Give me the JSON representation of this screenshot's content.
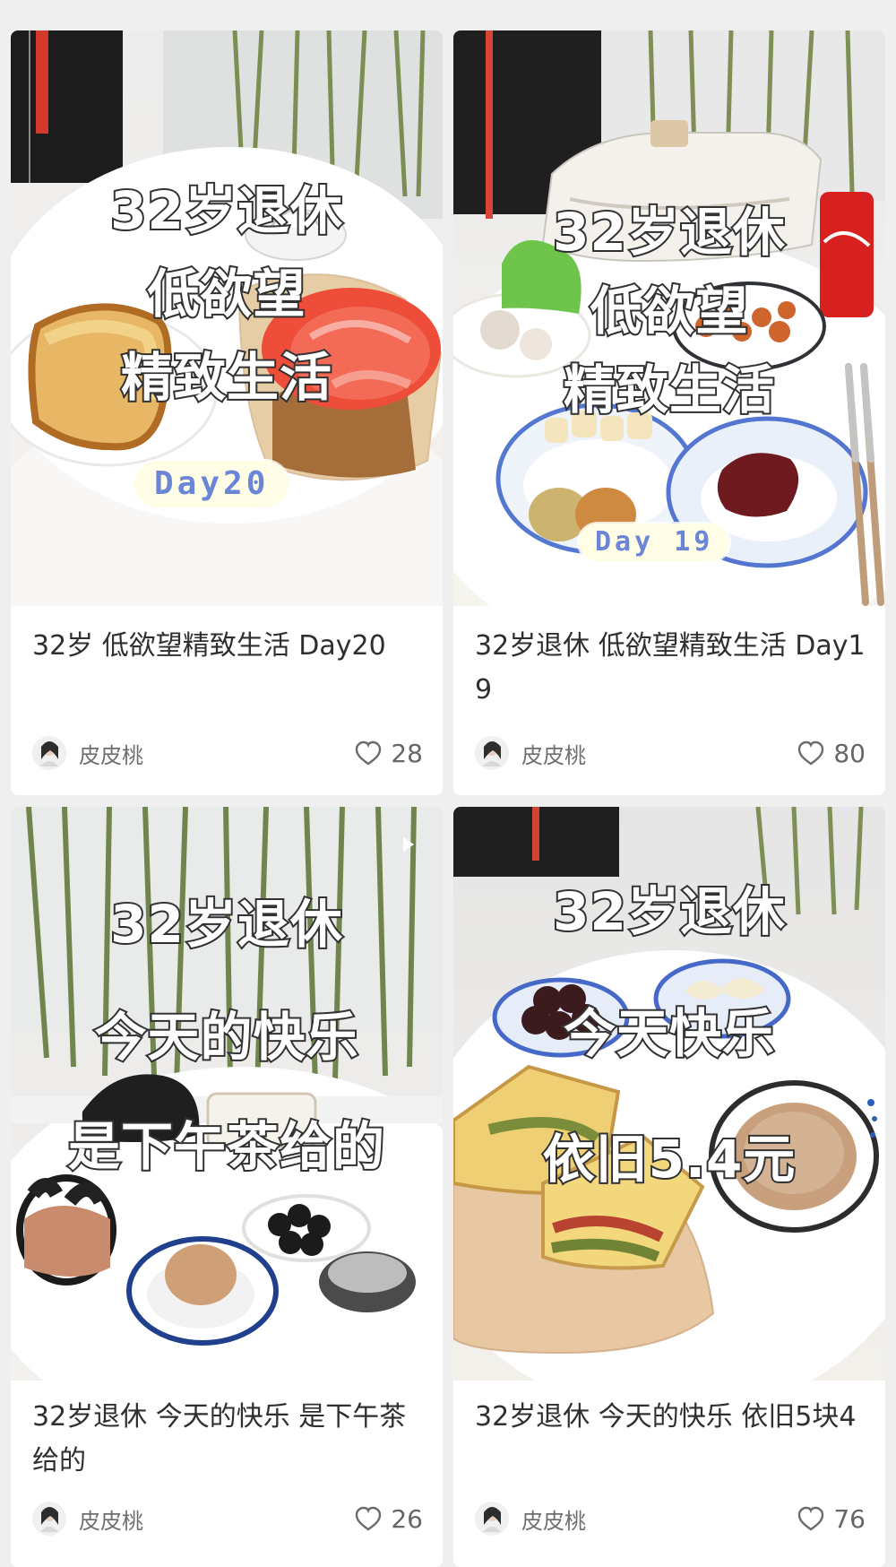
{
  "feed": {
    "cards": [
      {
        "image_text": [
          "32岁退休",
          "低欲望",
          "精致生活"
        ],
        "chip": "Day20",
        "title": "32岁 低欲望精致生活 Day20",
        "author": "皮皮桃",
        "likes": "28"
      },
      {
        "image_text": [
          "32岁退休",
          "低欲望",
          "精致生活"
        ],
        "chip": "Day 19",
        "title": "32岁退休 低欲望精致生活 Day19",
        "author": "皮皮桃",
        "likes": "80"
      },
      {
        "image_text": [
          "32岁退休",
          "今天的快乐",
          "是下午茶给的"
        ],
        "title": "32岁退休 今天的快乐 是下午茶给的",
        "author": "皮皮桃",
        "likes": "26"
      },
      {
        "image_text": [
          "32岁退休",
          "今天快乐",
          "依旧5.4元"
        ],
        "title": "32岁退休 今天的快乐 依旧5块4",
        "author": "皮皮桃",
        "likes": "76"
      }
    ]
  },
  "icons": {
    "heart": "heart-outline-icon",
    "play": "play-icon",
    "avatar": "avatar"
  },
  "colors": {
    "chip_text": "#6b86d7",
    "chip_bg": "#fffde6"
  }
}
